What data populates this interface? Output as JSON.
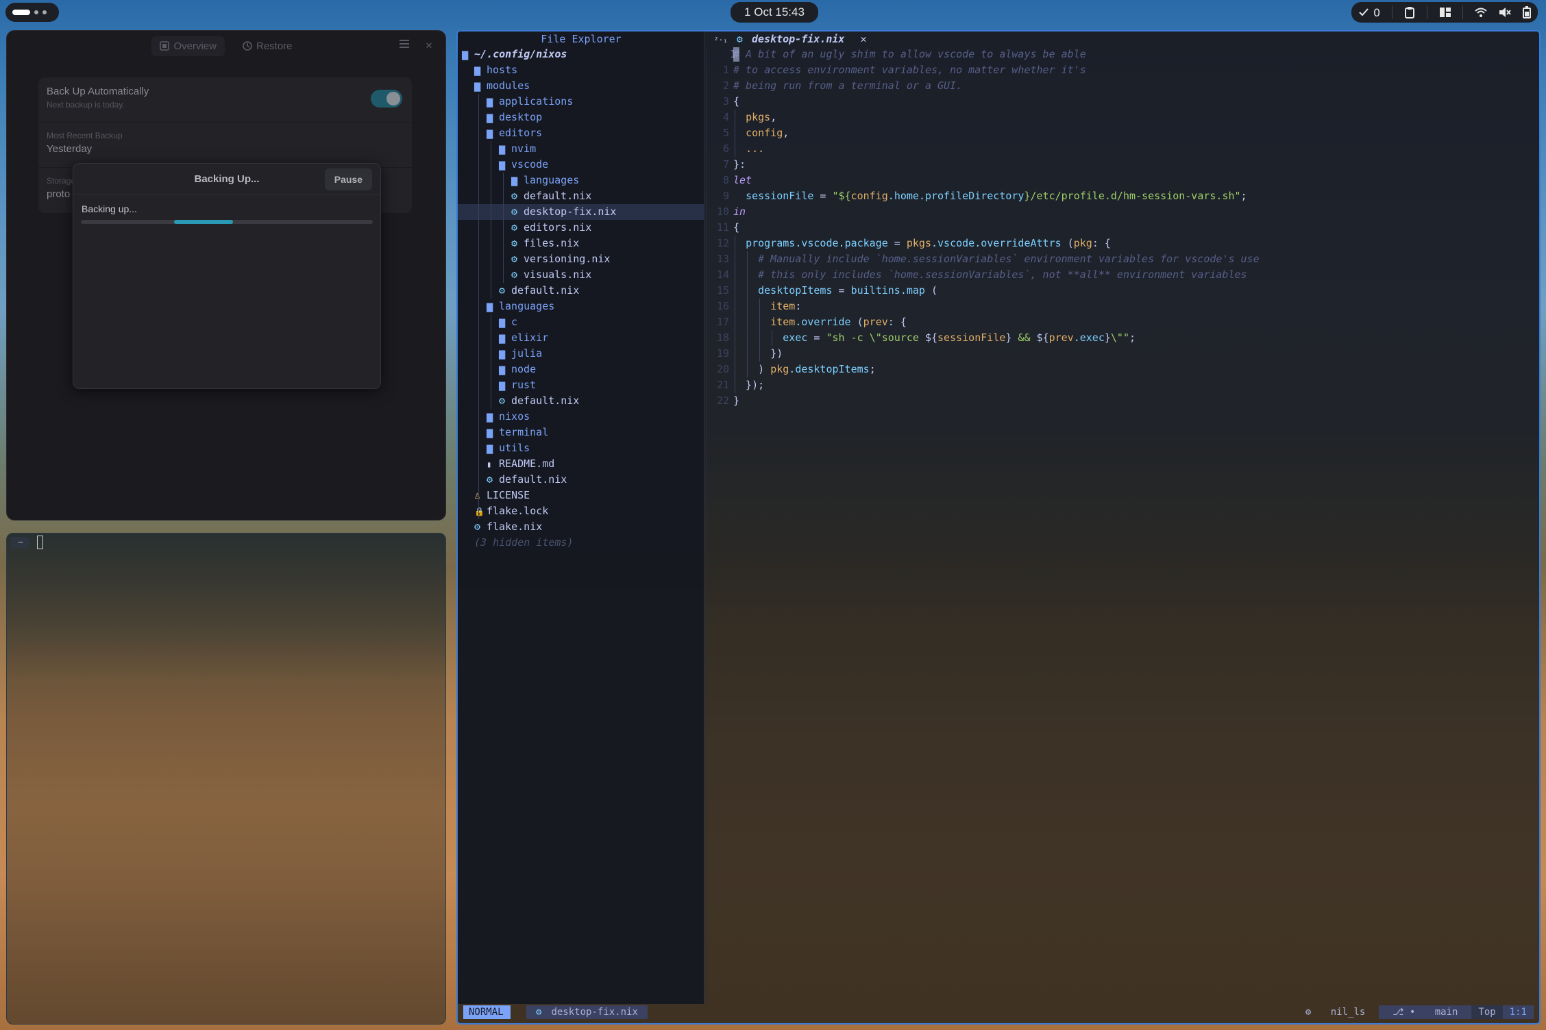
{
  "topbar": {
    "clock": "1 Oct 15:43",
    "notifications_count": "0",
    "icons": [
      "check-icon",
      "clipboard-icon",
      "layout-icon",
      "wifi-icon",
      "mute-icon",
      "battery-icon"
    ]
  },
  "backup": {
    "tabs": [
      "Overview",
      "Restore"
    ],
    "rows": [
      {
        "title": "Back Up Automatically",
        "sub": "Next backup is today."
      },
      {
        "label": "Most Recent Backup",
        "value": "Yesterday"
      },
      {
        "label": "Storage",
        "value": "proto"
      }
    ],
    "toggle_on": true,
    "dialog": {
      "title": "Backing Up...",
      "pause_label": "Pause",
      "status": "Backing up...",
      "progress_start": 0.32,
      "progress_end": 0.52
    }
  },
  "terminal": {
    "prompt": "~"
  },
  "nvim": {
    "explorer_title": "File Explorer",
    "tab_label": "desktop-fix.nix",
    "tab_prefix": "²·₁",
    "tree": [
      {
        "text": "~/.config/nixos",
        "icon": "folder-open",
        "depth": 0,
        "kind": "root"
      },
      {
        "text": "hosts",
        "icon": "folder",
        "depth": 1,
        "kind": "dir"
      },
      {
        "text": "modules",
        "icon": "folder-open",
        "depth": 1,
        "kind": "dir"
      },
      {
        "text": "applications",
        "icon": "folder",
        "depth": 2,
        "kind": "dir"
      },
      {
        "text": "desktop",
        "icon": "folder",
        "depth": 2,
        "kind": "dir"
      },
      {
        "text": "editors",
        "icon": "folder-open",
        "depth": 2,
        "kind": "dir"
      },
      {
        "text": "nvim",
        "icon": "folder",
        "depth": 3,
        "kind": "dir"
      },
      {
        "text": "vscode",
        "icon": "folder-open",
        "depth": 3,
        "kind": "dir"
      },
      {
        "text": "languages",
        "icon": "folder",
        "depth": 4,
        "kind": "dir"
      },
      {
        "text": "default.nix",
        "icon": "gear",
        "depth": 4,
        "kind": "file"
      },
      {
        "text": "desktop-fix.nix",
        "icon": "gear",
        "depth": 4,
        "kind": "file",
        "selected": true
      },
      {
        "text": "editors.nix",
        "icon": "gear",
        "depth": 4,
        "kind": "file"
      },
      {
        "text": "files.nix",
        "icon": "gear",
        "depth": 4,
        "kind": "file"
      },
      {
        "text": "versioning.nix",
        "icon": "gear",
        "depth": 4,
        "kind": "file"
      },
      {
        "text": "visuals.nix",
        "icon": "gear",
        "depth": 4,
        "kind": "file"
      },
      {
        "text": "default.nix",
        "icon": "gear",
        "depth": 3,
        "kind": "file"
      },
      {
        "text": "languages",
        "icon": "folder-open",
        "depth": 2,
        "kind": "dir"
      },
      {
        "text": "c",
        "icon": "folder",
        "depth": 3,
        "kind": "dir"
      },
      {
        "text": "elixir",
        "icon": "folder",
        "depth": 3,
        "kind": "dir"
      },
      {
        "text": "julia",
        "icon": "folder",
        "depth": 3,
        "kind": "dir"
      },
      {
        "text": "node",
        "icon": "folder",
        "depth": 3,
        "kind": "dir"
      },
      {
        "text": "rust",
        "icon": "folder",
        "depth": 3,
        "kind": "dir"
      },
      {
        "text": "default.nix",
        "icon": "gear",
        "depth": 3,
        "kind": "file"
      },
      {
        "text": "nixos",
        "icon": "folder",
        "depth": 2,
        "kind": "dir"
      },
      {
        "text": "terminal",
        "icon": "folder",
        "depth": 2,
        "kind": "dir"
      },
      {
        "text": "utils",
        "icon": "folder",
        "depth": 2,
        "kind": "dir"
      },
      {
        "text": "README.md",
        "icon": "doc",
        "depth": 2,
        "kind": "file"
      },
      {
        "text": "default.nix",
        "icon": "gear",
        "depth": 2,
        "kind": "file"
      },
      {
        "text": "LICENSE",
        "icon": "license",
        "depth": 1,
        "kind": "file"
      },
      {
        "text": "flake.lock",
        "icon": "lock",
        "depth": 1,
        "kind": "file"
      },
      {
        "text": "flake.nix",
        "icon": "gear",
        "depth": 1,
        "kind": "file"
      },
      {
        "text": "(3 hidden items)",
        "icon": "",
        "depth": 1,
        "kind": "hidden"
      }
    ],
    "line_numbers": [
      "1",
      "1",
      "2",
      "3",
      "4",
      "5",
      "6",
      "7",
      "8",
      "9",
      "10",
      "11",
      "12",
      "13",
      "14",
      "15",
      "16",
      "17",
      "18",
      "19",
      "20",
      "21",
      "22"
    ],
    "code": [
      [
        [
          "c",
          "# A bit of an ugly shim to allow vscode to always be able"
        ]
      ],
      [
        [
          "c",
          "# to access environment variables, no matter whether it's"
        ]
      ],
      [
        [
          "c",
          "# being run from a terminal or a GUI."
        ]
      ],
      [
        [
          "b",
          "{"
        ]
      ],
      [
        [
          "b",
          "  "
        ],
        [
          "p",
          "pkgs"
        ],
        [
          "b",
          ","
        ]
      ],
      [
        [
          "b",
          "  "
        ],
        [
          "p",
          "config"
        ],
        [
          "b",
          ","
        ]
      ],
      [
        [
          "b",
          "  "
        ],
        [
          "p",
          "..."
        ]
      ],
      [
        [
          "b",
          "}:"
        ]
      ],
      [
        [
          "k",
          "let"
        ]
      ],
      [
        [
          "b",
          "  "
        ],
        [
          "f",
          "sessionFile"
        ],
        [
          "b",
          " = "
        ],
        [
          "s",
          "\"${"
        ],
        [
          "p",
          "config"
        ],
        [
          "o",
          "."
        ],
        [
          "f",
          "home"
        ],
        [
          "o",
          "."
        ],
        [
          "f",
          "profileDirectory"
        ],
        [
          "s",
          "}/etc/profile.d/hm-session-vars.sh\""
        ],
        [
          "b",
          ";"
        ]
      ],
      [
        [
          "k",
          "in"
        ]
      ],
      [
        [
          "b",
          "{"
        ]
      ],
      [
        [
          "b",
          "  "
        ],
        [
          "f",
          "programs"
        ],
        [
          "o",
          "."
        ],
        [
          "f",
          "vscode"
        ],
        [
          "o",
          "."
        ],
        [
          "f",
          "package"
        ],
        [
          "b",
          " = "
        ],
        [
          "p",
          "pkgs"
        ],
        [
          "o",
          "."
        ],
        [
          "f",
          "vscode"
        ],
        [
          "o",
          "."
        ],
        [
          "f",
          "overrideAttrs"
        ],
        [
          "b",
          " ("
        ],
        [
          "p",
          "pkg"
        ],
        [
          "b",
          ": {"
        ]
      ],
      [
        [
          "b",
          "    "
        ],
        [
          "c",
          "# Manually include `home.sessionVariables` environment variables for vscode's use"
        ]
      ],
      [
        [
          "b",
          "    "
        ],
        [
          "c",
          "# this only includes `home.sessionVariables`, not **all** environment variables"
        ]
      ],
      [
        [
          "b",
          "    "
        ],
        [
          "f",
          "desktopItems"
        ],
        [
          "b",
          " = "
        ],
        [
          "f",
          "builtins"
        ],
        [
          "o",
          "."
        ],
        [
          "f",
          "map"
        ],
        [
          "b",
          " ("
        ]
      ],
      [
        [
          "b",
          "      "
        ],
        [
          "p",
          "item"
        ],
        [
          "b",
          ":"
        ]
      ],
      [
        [
          "b",
          "      "
        ],
        [
          "p",
          "item"
        ],
        [
          "o",
          "."
        ],
        [
          "f",
          "override"
        ],
        [
          "b",
          " ("
        ],
        [
          "p",
          "prev"
        ],
        [
          "b",
          ": {"
        ]
      ],
      [
        [
          "b",
          "        "
        ],
        [
          "f",
          "exec"
        ],
        [
          "b",
          " = "
        ],
        [
          "s",
          "\"sh -c \\\"source "
        ],
        [
          "b",
          "${"
        ],
        [
          "p",
          "sessionFile"
        ],
        [
          "b",
          "}"
        ],
        [
          "s",
          " && "
        ],
        [
          "b",
          "${"
        ],
        [
          "p",
          "prev"
        ],
        [
          "o",
          "."
        ],
        [
          "f",
          "exec"
        ],
        [
          "b",
          "}"
        ],
        [
          "s",
          "\\\"\""
        ],
        [
          "b",
          ";"
        ]
      ],
      [
        [
          "b",
          "      })"
        ]
      ],
      [
        [
          "b",
          "    ) "
        ],
        [
          "p",
          "pkg"
        ],
        [
          "o",
          "."
        ],
        [
          "f",
          "desktopItems"
        ],
        [
          "b",
          ";"
        ]
      ],
      [
        [
          "b",
          "  });"
        ]
      ],
      [
        [
          "b",
          "}"
        ]
      ]
    ],
    "status": {
      "mode": "NORMAL",
      "file": "desktop-fix.nix",
      "lsp": "nil_ls",
      "branch": "main",
      "scroll": "Top",
      "position": "1:1"
    }
  },
  "colors": {
    "accent": "#7aa2f7",
    "progress": "#2a9ab4",
    "border": "#3a7bd5"
  }
}
